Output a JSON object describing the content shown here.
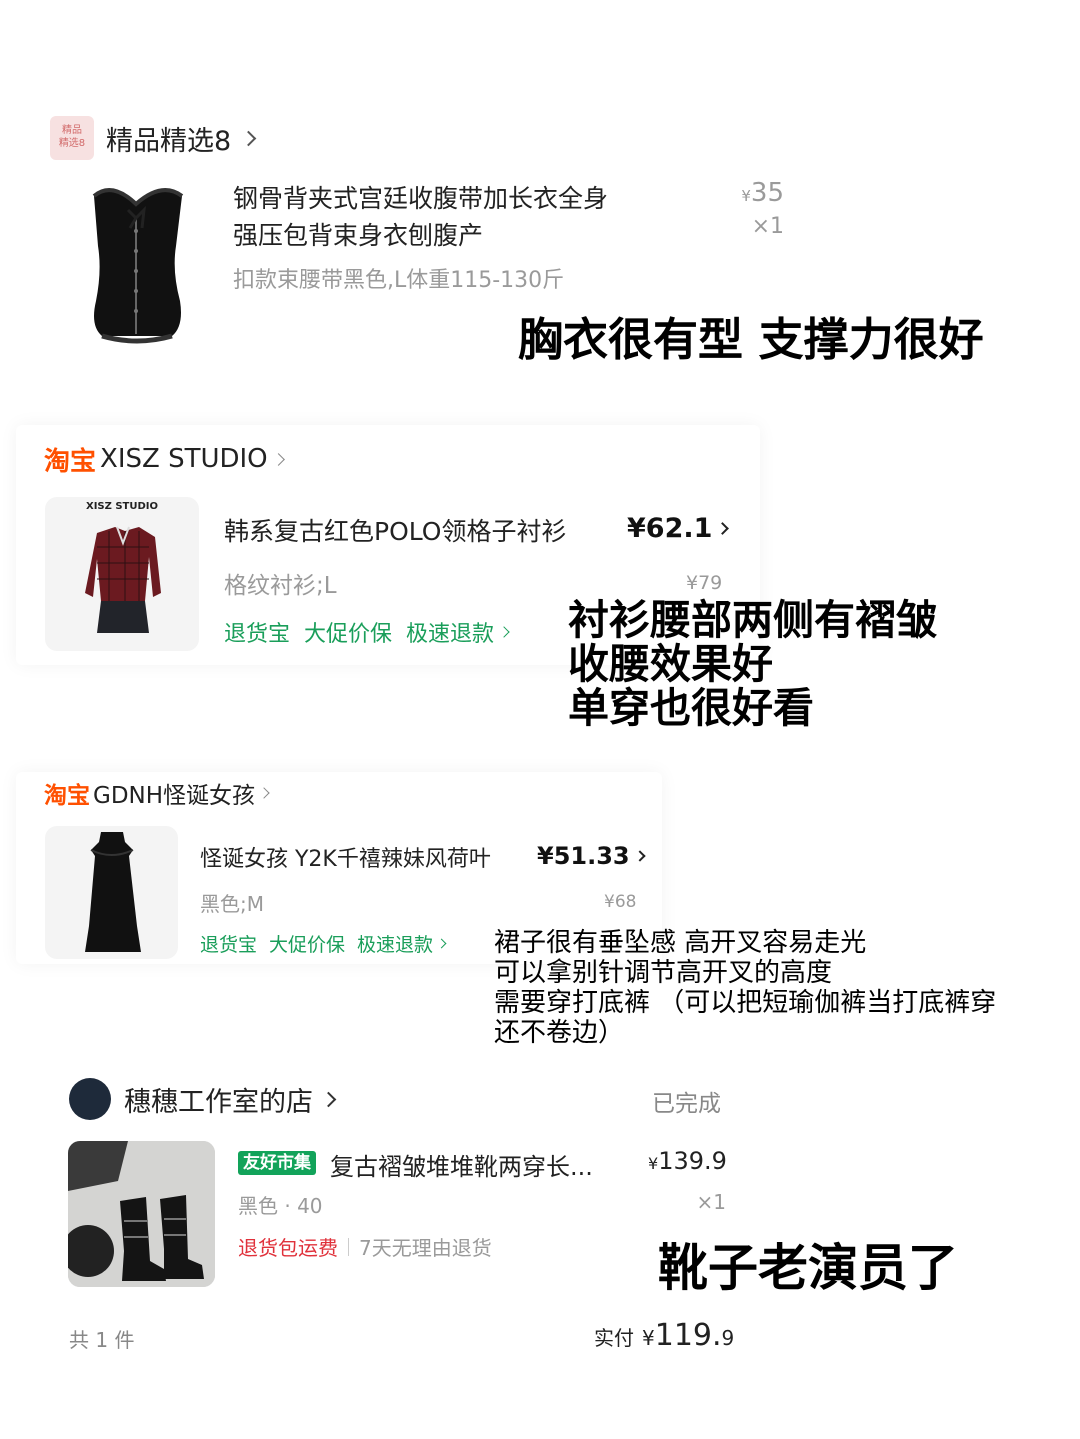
{
  "colors": {
    "taobao_orange": "#ff5000",
    "green_tag": "#1a9e5a",
    "red_tag": "#e0313b",
    "badge_bg": "#f7e1e1",
    "friendly_market_bg": "#12a35a"
  },
  "block1": {
    "badge_line1": "精品",
    "badge_line2": "精选8",
    "shop_name": "精品精选8",
    "title_line1": "钢骨背夹式宫廷收腹带加长衣全身",
    "title_line2": "强压包背束身衣刨腹产",
    "sku": "扣款束腰带黑色,L体重115-130斤",
    "currency": "¥",
    "price": "35",
    "qty": "×1",
    "caption": "胸衣很有型 支撑力很好"
  },
  "block2": {
    "taobao_logo": "淘宝",
    "shop_name": "XISZ STUDIO",
    "image_label": "XISZ STUDIO",
    "title": "韩系复古红色POLO领格子衬衫",
    "price": "¥62.1",
    "sku": "格纹衬衫;L",
    "original_price": "¥79",
    "tags": [
      "退货宝",
      "大促价保",
      "极速退款"
    ],
    "caption_lines": [
      "衬衫腰部两侧有褶皱",
      "收腰效果好",
      "单穿也很好看"
    ]
  },
  "block3": {
    "taobao_logo": "淘宝",
    "shop_name": "GDNH怪诞女孩",
    "title": "怪诞女孩 Y2K千禧辣妹风荷叶",
    "price": "¥51.33",
    "sku": "黑色;M",
    "original_price": "¥68",
    "tags": [
      "退货宝",
      "大促价保",
      "极速退款"
    ],
    "caption_lines": [
      "裙子很有垂坠感 高开叉容易走光",
      "可以拿别针调节高开叉的高度",
      "需要穿打底裤 （可以把短瑜伽裤当打底裤穿",
      "还不卷边）"
    ]
  },
  "block4": {
    "shop_name": "穗穗工作室的店",
    "status": "已完成",
    "market_badge": "友好市集",
    "title": "复古褶皱堆堆靴两穿长...",
    "currency": "¥",
    "price": "139.9",
    "sku": "黑色 · 40",
    "qty": "×1",
    "tag_red": "退货包运费",
    "tag_gray": "7天无理由退货",
    "caption": "靴子老演员了",
    "total_count": "共 1 件",
    "paid_label": "实付",
    "paid_currency": "¥",
    "paid_int": "119.",
    "paid_dec": "9"
  }
}
